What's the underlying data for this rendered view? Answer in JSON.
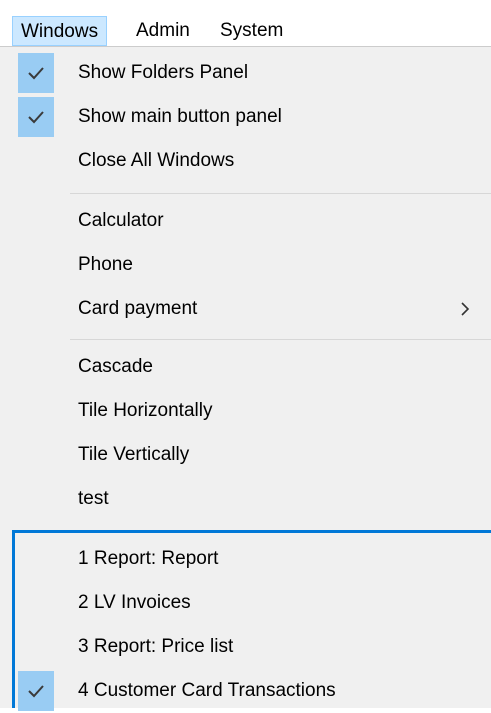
{
  "menubar": {
    "items": [
      {
        "label": "Windows"
      },
      {
        "label": "Admin"
      },
      {
        "label": "System"
      }
    ]
  },
  "menu": {
    "items": [
      {
        "label": "Show Folders Panel",
        "checked": true
      },
      {
        "label": "Show main button panel",
        "checked": true
      },
      {
        "label": "Close All Windows"
      },
      {
        "label": "Calculator"
      },
      {
        "label": "Phone"
      },
      {
        "label": "Card payment",
        "submenu": true
      },
      {
        "label": "Cascade"
      },
      {
        "label": "Tile Horizontally"
      },
      {
        "label": "Tile Vertically"
      },
      {
        "label": "test"
      },
      {
        "label": "1 Report: Report"
      },
      {
        "label": "2 LV Invoices"
      },
      {
        "label": "3 Report: Price list"
      },
      {
        "label": "4 Customer Card Transactions",
        "checked": true
      }
    ]
  },
  "colors": {
    "menu_background": "#f0f0f0",
    "check_highlight": "#99ccf3",
    "active_menubar": "#cce8ff",
    "focus_border": "#0078d7"
  },
  "icons": {
    "check": "checkmark-icon",
    "submenu": "chevron-right-icon"
  }
}
